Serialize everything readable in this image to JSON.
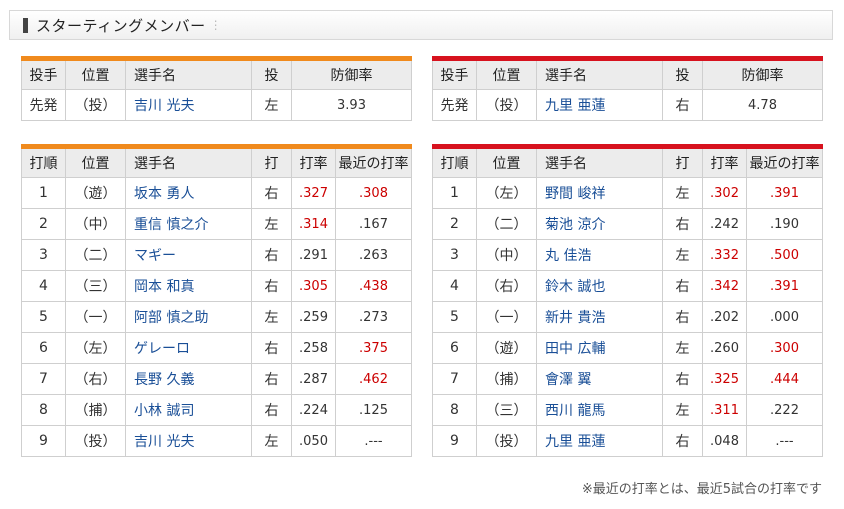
{
  "section": {
    "title": "スターティングメンバー"
  },
  "pitcher_header": {
    "role": "投手",
    "position": "位置",
    "name": "選手名",
    "throws": "投",
    "era": "防御率"
  },
  "batter_header": {
    "order": "打順",
    "position": "位置",
    "name": "選手名",
    "bats": "打",
    "avg": "打率",
    "recent": "最近の打率"
  },
  "left": {
    "accent_color": "#f08a1d",
    "pitcher": {
      "role": "先発",
      "position": "（投）",
      "name": "吉川 光夫",
      "throws": "左",
      "era": "3.93"
    },
    "batters": [
      {
        "order": "1",
        "position": "（遊）",
        "name": "坂本 勇人",
        "bats": "右",
        "avg": ".327",
        "avg_red": true,
        "recent": ".308",
        "recent_red": true
      },
      {
        "order": "2",
        "position": "（中）",
        "name": "重信 慎之介",
        "bats": "左",
        "avg": ".314",
        "avg_red": true,
        "recent": ".167",
        "recent_red": false
      },
      {
        "order": "3",
        "position": "（二）",
        "name": "マギー",
        "bats": "右",
        "avg": ".291",
        "avg_red": false,
        "recent": ".263",
        "recent_red": false
      },
      {
        "order": "4",
        "position": "（三）",
        "name": "岡本 和真",
        "bats": "右",
        "avg": ".305",
        "avg_red": true,
        "recent": ".438",
        "recent_red": true
      },
      {
        "order": "5",
        "position": "（一）",
        "name": "阿部 慎之助",
        "bats": "左",
        "avg": ".259",
        "avg_red": false,
        "recent": ".273",
        "recent_red": false
      },
      {
        "order": "6",
        "position": "（左）",
        "name": "ゲレーロ",
        "bats": "右",
        "avg": ".258",
        "avg_red": false,
        "recent": ".375",
        "recent_red": true
      },
      {
        "order": "7",
        "position": "（右）",
        "name": "長野 久義",
        "bats": "右",
        "avg": ".287",
        "avg_red": false,
        "recent": ".462",
        "recent_red": true
      },
      {
        "order": "8",
        "position": "（捕）",
        "name": "小林 誠司",
        "bats": "右",
        "avg": ".224",
        "avg_red": false,
        "recent": ".125",
        "recent_red": false
      },
      {
        "order": "9",
        "position": "（投）",
        "name": "吉川 光夫",
        "bats": "左",
        "avg": ".050",
        "avg_red": false,
        "recent": ".---",
        "recent_red": false
      }
    ]
  },
  "right": {
    "accent_color": "#d7121e",
    "pitcher": {
      "role": "先発",
      "position": "（投）",
      "name": "九里 亜蓮",
      "throws": "右",
      "era": "4.78"
    },
    "batters": [
      {
        "order": "1",
        "position": "（左）",
        "name": "野間 峻祥",
        "bats": "左",
        "avg": ".302",
        "avg_red": true,
        "recent": ".391",
        "recent_red": true
      },
      {
        "order": "2",
        "position": "（二）",
        "name": "菊池 涼介",
        "bats": "右",
        "avg": ".242",
        "avg_red": false,
        "recent": ".190",
        "recent_red": false
      },
      {
        "order": "3",
        "position": "（中）",
        "name": "丸 佳浩",
        "bats": "左",
        "avg": ".332",
        "avg_red": true,
        "recent": ".500",
        "recent_red": true
      },
      {
        "order": "4",
        "position": "（右）",
        "name": "鈴木 誠也",
        "bats": "右",
        "avg": ".342",
        "avg_red": true,
        "recent": ".391",
        "recent_red": true
      },
      {
        "order": "5",
        "position": "（一）",
        "name": "新井 貴浩",
        "bats": "右",
        "avg": ".202",
        "avg_red": false,
        "recent": ".000",
        "recent_red": false
      },
      {
        "order": "6",
        "position": "（遊）",
        "name": "田中 広輔",
        "bats": "左",
        "avg": ".260",
        "avg_red": false,
        "recent": ".300",
        "recent_red": true
      },
      {
        "order": "7",
        "position": "（捕）",
        "name": "會澤 翼",
        "bats": "右",
        "avg": ".325",
        "avg_red": true,
        "recent": ".444",
        "recent_red": true
      },
      {
        "order": "8",
        "position": "（三）",
        "name": "西川 龍馬",
        "bats": "左",
        "avg": ".311",
        "avg_red": true,
        "recent": ".222",
        "recent_red": false
      },
      {
        "order": "9",
        "position": "（投）",
        "name": "九里 亜蓮",
        "bats": "右",
        "avg": ".048",
        "avg_red": false,
        "recent": ".---",
        "recent_red": false
      }
    ]
  },
  "footnote": "※最近の打率とは、最近5試合の打率です"
}
